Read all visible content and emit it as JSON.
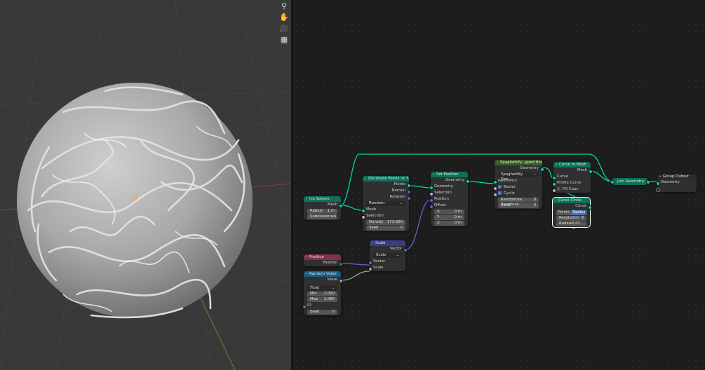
{
  "viewport": {
    "tools": [
      {
        "icon": "zoom-icon",
        "glyph": "⚲"
      },
      {
        "icon": "hand-icon",
        "glyph": "✋"
      },
      {
        "icon": "camera-icon",
        "glyph": "🎥"
      },
      {
        "icon": "grid-icon",
        "glyph": "▦"
      }
    ]
  },
  "nodes": {
    "ico_sphere": {
      "title": "Ico Sphere",
      "out_mesh": "Mesh",
      "radius_label": "Radius",
      "radius_value": "1 m",
      "subdiv_label": "Subdivisions",
      "subdiv_value": "4"
    },
    "distribute": {
      "title": "Distribute Points on Faces",
      "out_points": "Points",
      "out_normal": "Normal",
      "out_rotation": "Rotation",
      "mode": "Random",
      "in_mesh": "Mesh",
      "in_selection": "Selection",
      "density_label": "Density",
      "density_value": "173.600",
      "seed_label": "Seed",
      "seed_value": "0"
    },
    "set_position": {
      "title": "Set Position",
      "out_geometry": "Geometry",
      "in_geometry": "Geometry",
      "in_selection": "Selection",
      "in_position": "Position",
      "offset_label": "Offset:",
      "x_label": "X",
      "x_value": "0 m",
      "y_label": "Y",
      "y_value": "0 m",
      "z_label": "Z",
      "z_value": "0 m"
    },
    "spaghettify": {
      "title": "Spaghettify...pped this",
      "out_geometry": "Geometry",
      "group_name": "Spaghettify Geo...",
      "in_geometry": "Geometry",
      "bezier_label": "Bezier",
      "cyclic_label": "Cyclic",
      "randomize_label": "Randomize Iterations",
      "randomize_value": "0",
      "seed_label": "Seed",
      "seed_value": "0"
    },
    "curve_to_mesh": {
      "title": "Curve to Mesh",
      "out_mesh": "Mesh",
      "in_curve": "Curve",
      "in_profile": "Profile Curve",
      "fill_caps_label": "Fill Caps"
    },
    "curve_circle": {
      "title": "Curve Circle",
      "out_curve": "Curve",
      "mode_points": "Points",
      "mode_radius": "Radius",
      "resolution_label": "Resolution",
      "resolution_value": "8",
      "radius_label": "Radius",
      "radius_value": "0.01 m"
    },
    "join_geometry": {
      "title": "Join Geometry"
    },
    "group_output": {
      "title": "Group Output",
      "in_geometry": "Geometry"
    },
    "scale": {
      "title": "Scale",
      "out_vector": "Vector",
      "mode": "Scale",
      "in_vector": "Vector",
      "in_scale": "Scale"
    },
    "position": {
      "title": "Position",
      "out_position": "Position"
    },
    "random_value": {
      "title": "Random Value",
      "out_value": "Value",
      "type": "Float",
      "min_label": "Min",
      "min_value": "1.000",
      "max_label": "Max",
      "max_value": "1.080",
      "id_label": "ID",
      "seed_label": "Seed",
      "seed_value": "0"
    }
  }
}
